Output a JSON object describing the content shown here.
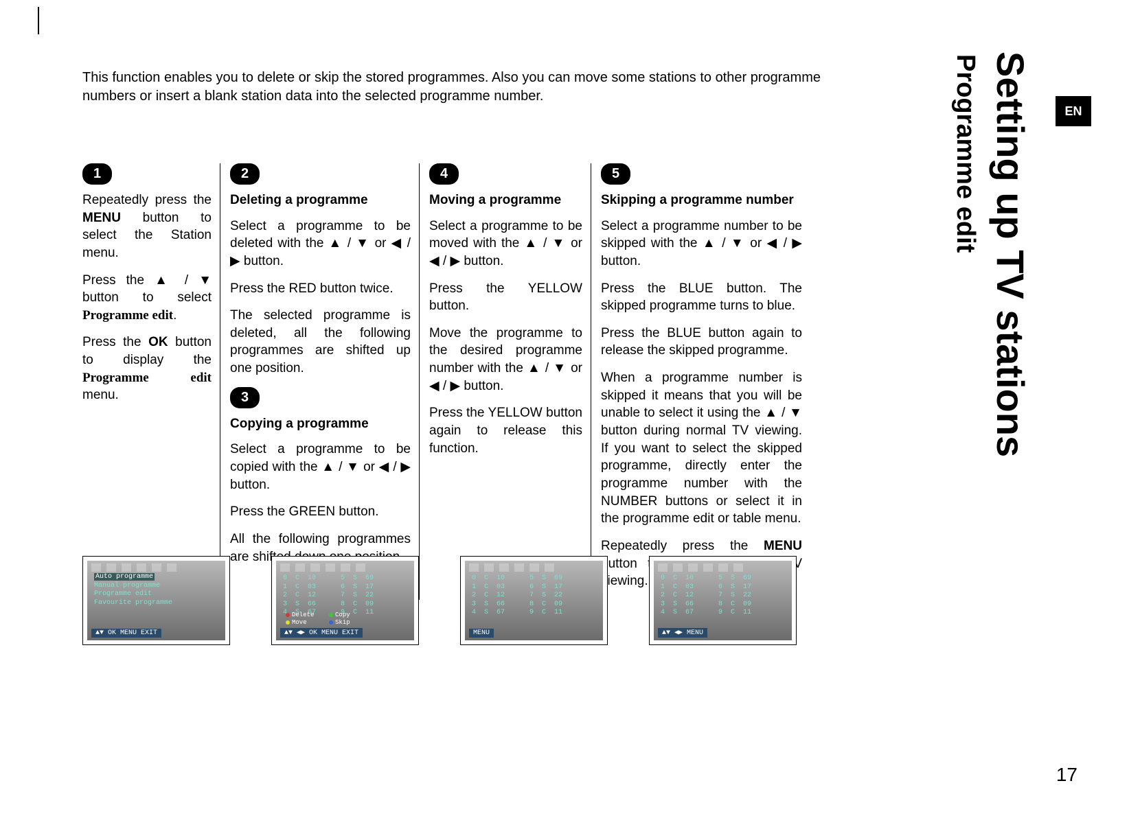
{
  "lang_badge": "EN",
  "side_title_main": "Setting up TV stations",
  "side_title_sub": "Programme edit",
  "intro": "This function enables you to delete or skip the stored programmes. Also you can move some stations to other programme numbers or insert a blank station data into the selected programme number.",
  "step1": {
    "num": "1",
    "p1a": "Repeatedly press the ",
    "p1b": "MENU",
    "p1c": " button to select the Station menu.",
    "p2a": "Press the ▲ / ▼ button to select ",
    "p2b": "Programme edit",
    "p2c": ".",
    "p3a": "Press the ",
    "p3b": "OK",
    "p3c": " button to display the ",
    "p3d": "Programme edit",
    "p3e": " menu."
  },
  "step2": {
    "num": "2",
    "title": "Deleting a programme",
    "p1": "Select a programme to be deleted with the ▲ / ▼ or ◀ / ▶ button.",
    "p2": "Press the RED button twice.",
    "p3": "The selected programme is deleted, all the following programmes are shifted up one position."
  },
  "step3": {
    "num": "3",
    "title": "Copying a programme",
    "p1": "Select a programme to be copied with the ▲ / ▼ or ◀ / ▶ button.",
    "p2": "Press the GREEN button.",
    "p3": "All the following programmes are shifted down one position."
  },
  "step4": {
    "num": "4",
    "title": "Moving a programme",
    "p1": "Select a programme to be moved with the ▲ / ▼ or ◀ / ▶ button.",
    "p2": "Press the YELLOW button.",
    "p3": "Move the programme to the desired programme number with the ▲ / ▼ or ◀ / ▶ button.",
    "p4": "Press the YELLOW button again to release this function."
  },
  "step5": {
    "num": "5",
    "title": "Skipping a programme number",
    "p1": "Select a programme number to be skipped with the ▲ / ▼ or ◀ / ▶ button.",
    "p2": "Press the BLUE button. The skipped programme turns to blue.",
    "p3": "Press the BLUE button again to release the skipped programme.",
    "p4": "When a programme number is skipped it means that you will be unable to select it using the ▲ / ▼ button during normal TV viewing. If you want to select the skipped programme, directly enter the programme number with the NUMBER buttons or select it in the programme edit or table menu.",
    "p5a": "Repeatedly press the ",
    "p5b": "MENU",
    "p5c": " button to return to normal TV viewing."
  },
  "shot1": {
    "line1": "Auto programme",
    "line2": "Manual programme",
    "line3": "Programme edit",
    "line4": "Favourite programme",
    "footer": "▲▼ OK MENU EXIT"
  },
  "shot2": {
    "rows": "0  C  10      5  S  69\n1  C  03      6  S  17\n2  C  12      7  S  22\n3  S  66      8  C  09\n4  S  67      9  C  11",
    "legend_delete": "Delete",
    "legend_copy": "Copy",
    "legend_move": "Move",
    "legend_skip": "Skip",
    "footer": "▲▼ ◀▶ OK MENU EXIT"
  },
  "shot3": {
    "rows": "0  C  10      5  S  69\n1  C  03      6  S  17\n2  C  12      7  S  22\n3  S  66      8  C  09\n4  S  67      9  C  11",
    "footer": "MENU"
  },
  "shot4": {
    "rows": "0  C  10      5  S  69\n1  C  03      6  S  17\n2  C  12      7  S  22\n3  S  66      8  C  09\n4  S  67      9  C  11",
    "footer": "▲▼ ◀▶ MENU"
  },
  "page_number": "17"
}
